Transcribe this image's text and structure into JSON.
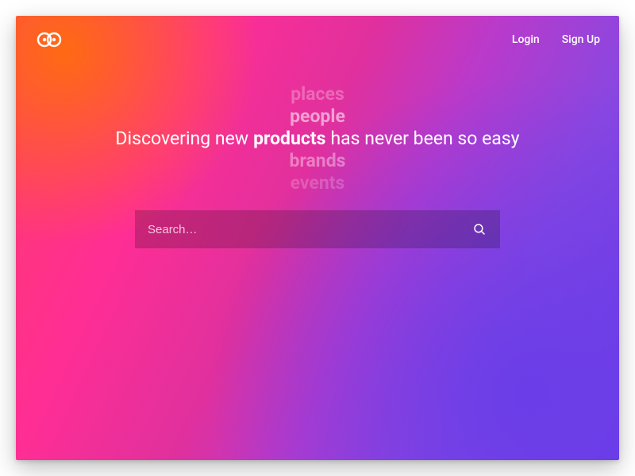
{
  "nav": {
    "login": "Login",
    "signup": "Sign Up"
  },
  "hero": {
    "prefix": "Discovering new",
    "suffix": "has never been so easy",
    "words": [
      "places",
      "people",
      "products",
      "brands",
      "events"
    ],
    "active_index": 2
  },
  "search": {
    "placeholder": "Search…"
  }
}
